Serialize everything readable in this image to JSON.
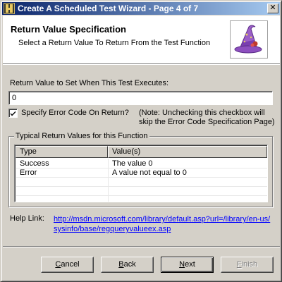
{
  "window": {
    "title": "Create A Scheduled Test Wizard - Page 4 of 7",
    "close_glyph": "✕"
  },
  "header": {
    "title": "Return Value Specification",
    "subtitle": "Select a Return Value To Return From the Test Function",
    "image_icon": "wizard-hat-icon"
  },
  "return_value": {
    "label": "Return Value to Set When This Test Executes:",
    "value": "0"
  },
  "error_code": {
    "checked": true,
    "label": "Specify Error Code On Return?",
    "note_line1": "(Note: Unchecking this checkbox will",
    "note_line2": "skip the Error Code Specification Page)"
  },
  "typical_values": {
    "group_title": "Typical Return Values for this Function",
    "columns": [
      "Type",
      "Value(s)"
    ],
    "rows": [
      {
        "type": "Success",
        "value": "The value 0"
      },
      {
        "type": "Error",
        "value": "A value not equal to 0"
      }
    ]
  },
  "help": {
    "label": "Help Link:",
    "link_text": "http://msdn.microsoft.com/library/default.asp?url=/library/en-us/sysinfo/base/regqueryvalueex.asp"
  },
  "buttons": {
    "cancel": {
      "pre": "",
      "accel": "C",
      "post": "ancel"
    },
    "back": {
      "pre": "",
      "accel": "B",
      "post": "ack"
    },
    "next": {
      "pre": "",
      "accel": "N",
      "post": "ext"
    },
    "finish": {
      "pre": "",
      "accel": "F",
      "post": "inish"
    }
  },
  "colors": {
    "title_gradient_start": "#0a246a",
    "title_gradient_end": "#a6caf0",
    "link": "#0000ff",
    "dialog_face": "#d4d0c8"
  }
}
